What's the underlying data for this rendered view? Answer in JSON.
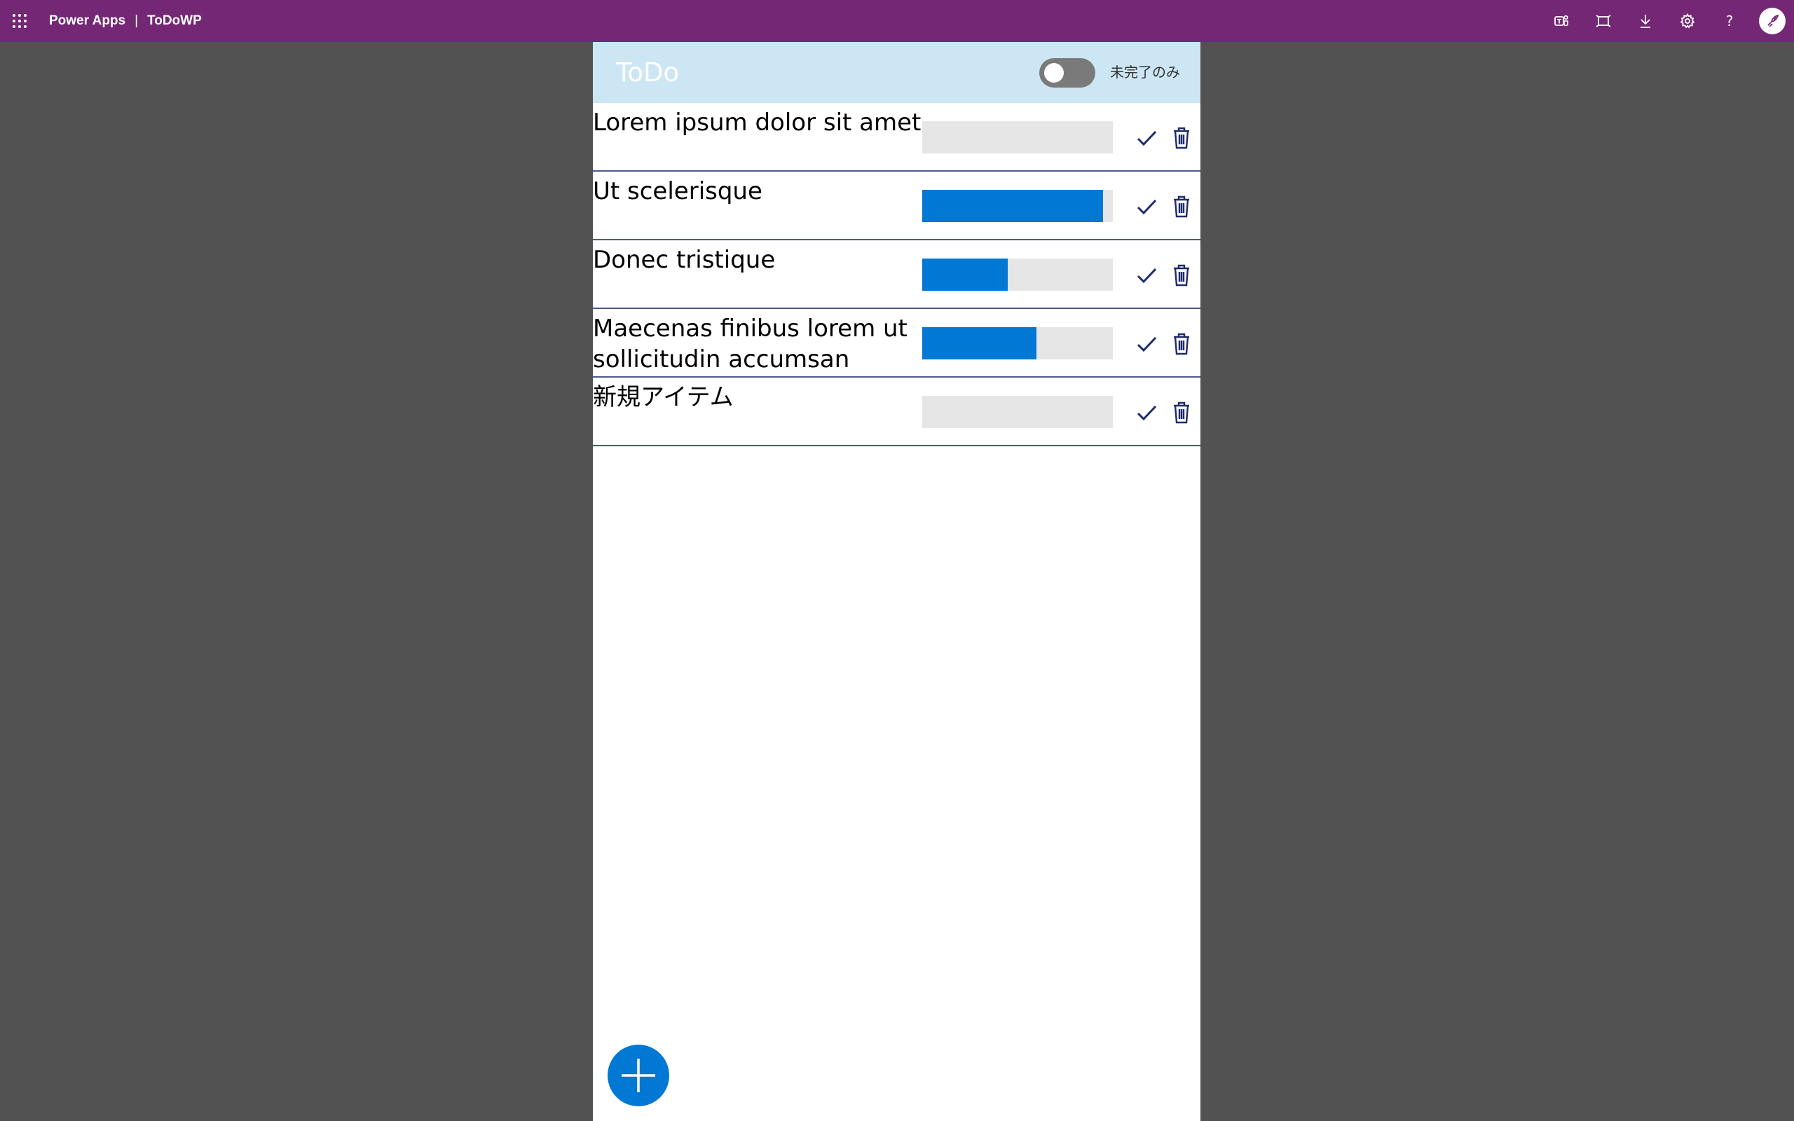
{
  "topbar": {
    "app_name": "Power Apps",
    "separator": "|",
    "file_name": "ToDoWP",
    "icons": [
      "waffle-icon",
      "teams-icon",
      "fit-to-window-icon",
      "download-icon",
      "settings-icon",
      "help-icon",
      "user-avatar"
    ],
    "background": "#742774"
  },
  "app": {
    "title": "ToDo",
    "filter_toggle": {
      "label": "未完了のみ",
      "on": false
    },
    "header_color": "#cde6f4",
    "accent_color": "#0078d4",
    "items": [
      {
        "title": "Lorem ipsum dolor sit amet",
        "progress": 0
      },
      {
        "title": "Ut scelerisque",
        "progress": 0.95
      },
      {
        "title": "Donec tristique",
        "progress": 0.45
      },
      {
        "title": "Maecenas finibus lorem ut sollicitudin accumsan",
        "progress": 0.6
      },
      {
        "title": "新規アイテム",
        "progress": 0
      }
    ],
    "add_button_icon": "plus-icon",
    "row_icons": [
      "check-icon",
      "trash-icon"
    ]
  }
}
